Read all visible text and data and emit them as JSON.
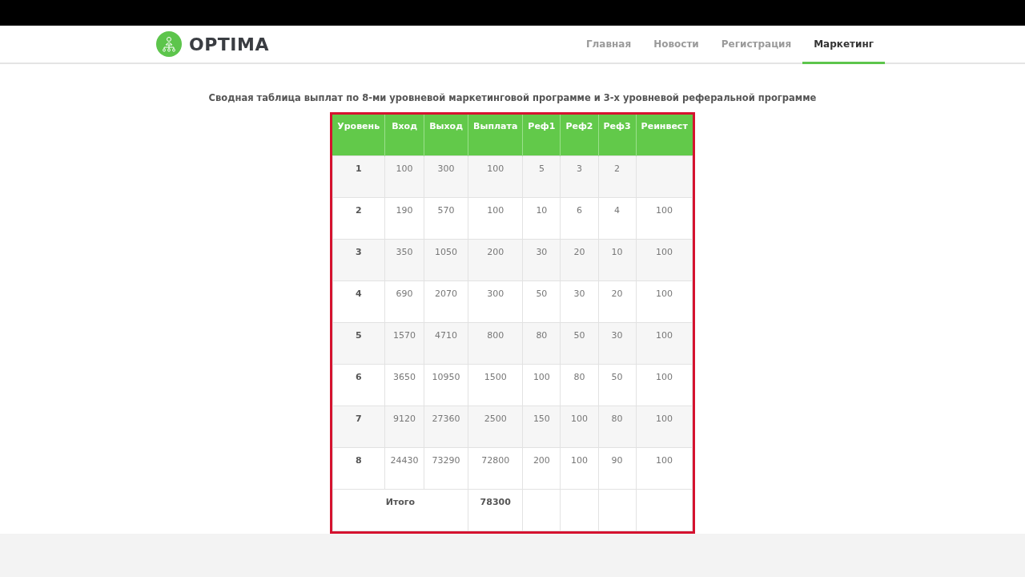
{
  "header": {
    "logo_text": "OPTIMA",
    "nav": [
      {
        "label": "Главная",
        "selected": false
      },
      {
        "label": "Новости",
        "selected": false
      },
      {
        "label": "Регистрация",
        "selected": false
      },
      {
        "label": "Маркетинг",
        "selected": true
      }
    ]
  },
  "title": "Сводная таблица выплат по 8-ми уровневой маркетинговой программе и 3-х уровневой реферальной программе",
  "table": {
    "columns": [
      "Уровень",
      "Вход",
      "Выход",
      "Выплата",
      "Реф1",
      "Реф2",
      "Реф3",
      "Реинвест"
    ],
    "rows": [
      [
        "1",
        "100",
        "300",
        "100",
        "5",
        "3",
        "2",
        null
      ],
      [
        "2",
        "190",
        "570",
        "100",
        "10",
        "6",
        "4",
        "100"
      ],
      [
        "3",
        "350",
        "1050",
        "200",
        "30",
        "20",
        "10",
        "100"
      ],
      [
        "4",
        "690",
        "2070",
        "300",
        "50",
        "30",
        "20",
        "100"
      ],
      [
        "5",
        "1570",
        "4710",
        "800",
        "80",
        "50",
        "30",
        "100"
      ],
      [
        "6",
        "3650",
        "10950",
        "1500",
        "100",
        "80",
        "50",
        "100"
      ],
      [
        "7",
        "9120",
        "27360",
        "2500",
        "150",
        "100",
        "80",
        "100"
      ],
      [
        "8",
        "24430",
        "73290",
        "72800",
        "200",
        "100",
        "90",
        "100"
      ]
    ],
    "total": {
      "label": "Итого",
      "value": "78300"
    }
  }
}
